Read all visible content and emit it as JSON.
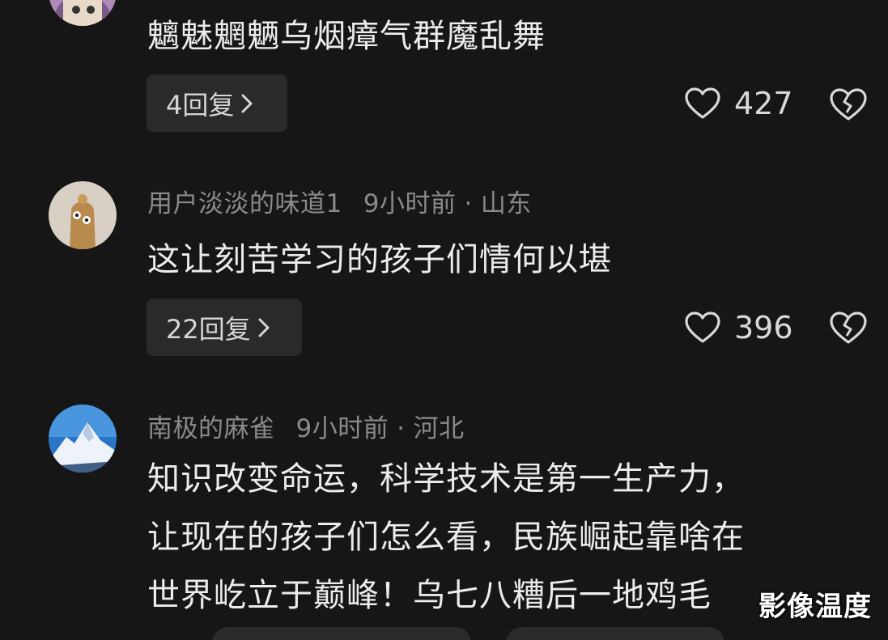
{
  "comments": [
    {
      "text": "魑魅魍魉乌烟瘴气群魔乱舞",
      "reply_label": "4回复",
      "likes": "427"
    },
    {
      "username": "用户淡淡的味道1",
      "time": "9小时前",
      "separator": "·",
      "location": "山东",
      "text": "这让刻苦学习的孩子们情何以堪",
      "reply_label": "22回复",
      "likes": "396"
    },
    {
      "username": "南极的麻雀",
      "time": "9小时前",
      "separator": "·",
      "location": "河北",
      "text_lines": [
        "知识改变命运，科学技术是第一生产力，",
        "让现在的孩子们怎么看，民族崛起靠啥在",
        "世界屹立于巅峰！乌七八糟后一地鸡毛"
      ]
    }
  ],
  "watermark": "影像温度",
  "icons": {
    "like": "heart-outline-icon",
    "dislike": "broken-heart-icon",
    "reply_arrow": "chevron-right-icon"
  },
  "colors": {
    "background": "#161616",
    "reply_button_bg": "#2a2a2a",
    "meta_text": "#8a8a8a",
    "body_text": "#ececec"
  }
}
